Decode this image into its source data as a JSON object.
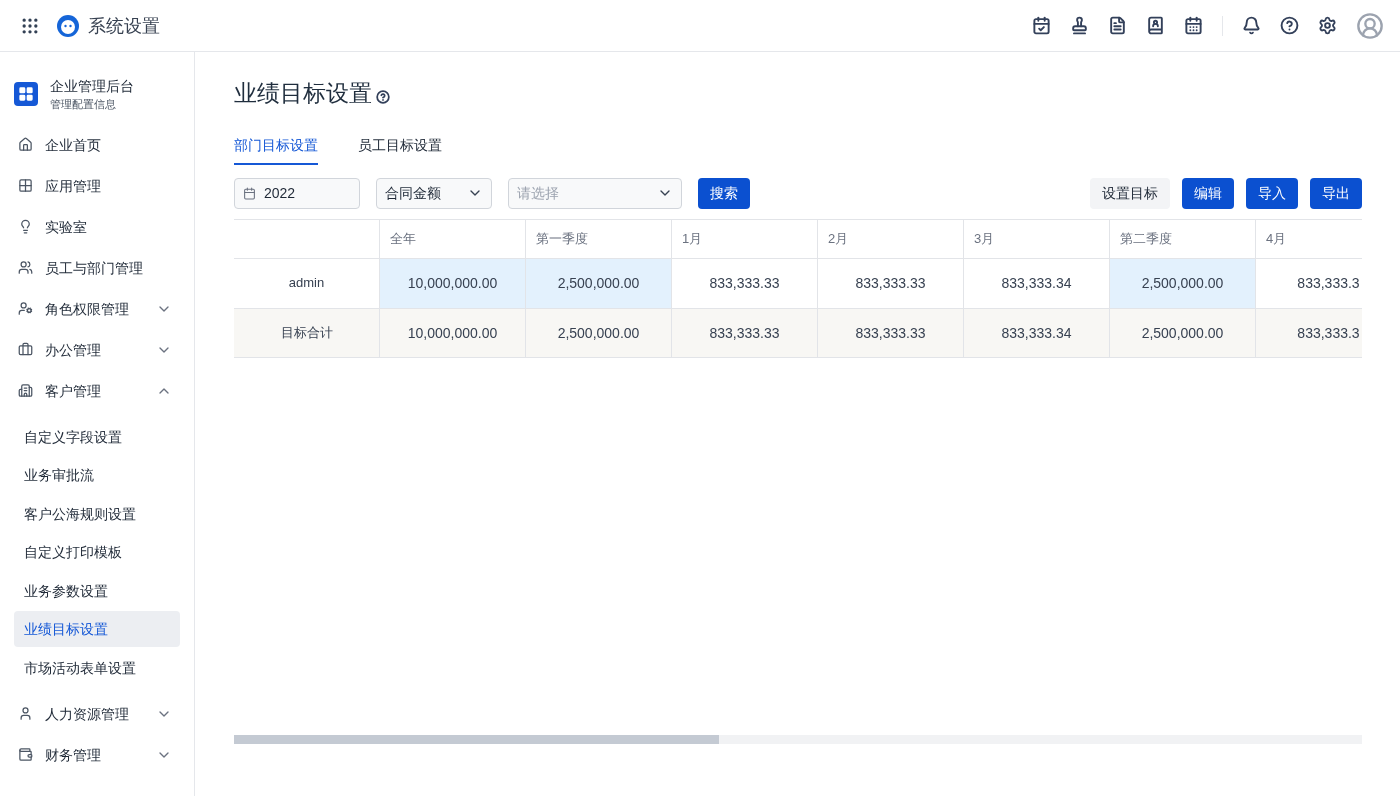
{
  "topbar": {
    "title": "系统设置"
  },
  "sidebar": {
    "header": {
      "title": "企业管理后台",
      "subtitle": "管理配置信息"
    },
    "items": [
      {
        "label": "企业首页",
        "kind": "link"
      },
      {
        "label": "应用管理",
        "kind": "link"
      },
      {
        "label": "实验室",
        "kind": "link"
      },
      {
        "label": "员工与部门管理",
        "kind": "link"
      },
      {
        "label": "角色权限管理",
        "kind": "group",
        "expanded": false
      },
      {
        "label": "办公管理",
        "kind": "group",
        "expanded": false
      },
      {
        "label": "客户管理",
        "kind": "group",
        "expanded": true,
        "children": [
          {
            "label": "自定义字段设置",
            "selected": false
          },
          {
            "label": "业务审批流",
            "selected": false
          },
          {
            "label": "客户公海规则设置",
            "selected": false
          },
          {
            "label": "自定义打印模板",
            "selected": false
          },
          {
            "label": "业务参数设置",
            "selected": false
          },
          {
            "label": "业绩目标设置",
            "selected": true
          },
          {
            "label": "市场活动表单设置",
            "selected": false
          }
        ]
      },
      {
        "label": "人力资源管理",
        "kind": "group",
        "expanded": false
      },
      {
        "label": "财务管理",
        "kind": "group",
        "expanded": false
      }
    ]
  },
  "page": {
    "title": "业绩目标设置",
    "tabs": [
      {
        "label": "部门目标设置",
        "selected": true
      },
      {
        "label": "员工目标设置",
        "selected": false
      }
    ],
    "filters": {
      "year": "2022",
      "metric": "合同金额",
      "scope_placeholder": "请选择",
      "search_button": "搜索"
    },
    "actions": [
      {
        "label": "设置目标",
        "kind": "secondary"
      },
      {
        "label": "编辑",
        "kind": "primary"
      },
      {
        "label": "导入",
        "kind": "primary"
      },
      {
        "label": "导出",
        "kind": "primary"
      }
    ],
    "table": {
      "columns": [
        {
          "label": "全年",
          "kind": "summary"
        },
        {
          "label": "第一季度",
          "kind": "summary"
        },
        {
          "label": "1月",
          "kind": "month"
        },
        {
          "label": "2月",
          "kind": "month"
        },
        {
          "label": "3月",
          "kind": "month"
        },
        {
          "label": "第二季度",
          "kind": "summary"
        },
        {
          "label": "4月",
          "kind": "month"
        }
      ],
      "rows": [
        {
          "label": "admin",
          "kind": "member",
          "cells": [
            "10,000,000.00",
            "2,500,000.00",
            "833,333.33",
            "833,333.33",
            "833,333.34",
            "2,500,000.00",
            "833,333.3"
          ]
        },
        {
          "label": "目标合计",
          "kind": "total",
          "cells": [
            "10,000,000.00",
            "2,500,000.00",
            "833,333.33",
            "833,333.33",
            "833,333.34",
            "2,500,000.00",
            "833,333.3"
          ]
        }
      ]
    }
  }
}
